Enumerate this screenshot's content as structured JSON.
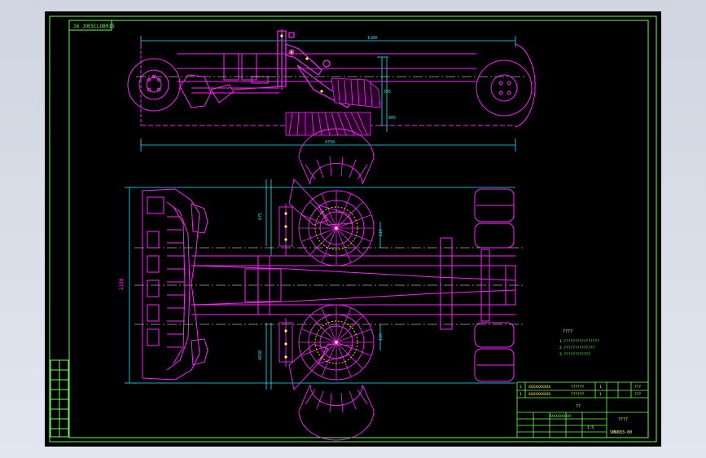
{
  "drawing": {
    "drawing_code": "16 JOESCLOB915",
    "colors": {
      "background": "#000000",
      "frame": "#6dff52",
      "part_lines": "#ff22ff",
      "dimensions": "#22e6ff",
      "centerlines": "#ffffff",
      "text": "#ffff55",
      "canvas": "#d6dbe6"
    },
    "dimensions": {
      "top_overall": "1380",
      "top_total": "4750",
      "top_right_h1": "395",
      "top_right_h2": "805",
      "plan_left_a": "875",
      "plan_left_b": "4650",
      "plan_height": "2350",
      "plan_right_a": "115",
      "plan_right_b": "115"
    },
    "technical_requirements": {
      "heading": "????",
      "lines": [
        "1.????????????????",
        "2.??????????????",
        "3.????????????"
      ]
    },
    "revision_block": {
      "rows": [
        "",
        "",
        "",
        "",
        "",
        "",
        "",
        "",
        ""
      ]
    },
    "title_block": {
      "part_rows": [
        {
          "no": "2",
          "code": "XXXXXXXXXX",
          "name": "??????",
          "qty": "1",
          "mat": "",
          "note": "???"
        },
        {
          "no": "1",
          "code": "XXXXXXXXXX",
          "name": "??????",
          "qty": "1",
          "mat": "",
          "note": "???"
        }
      ],
      "company": "??",
      "drawing_name": "????",
      "ref_label": "XXXXXXXXXXX",
      "scale": "1:5",
      "sheet_code": "SMKK03-00"
    }
  }
}
